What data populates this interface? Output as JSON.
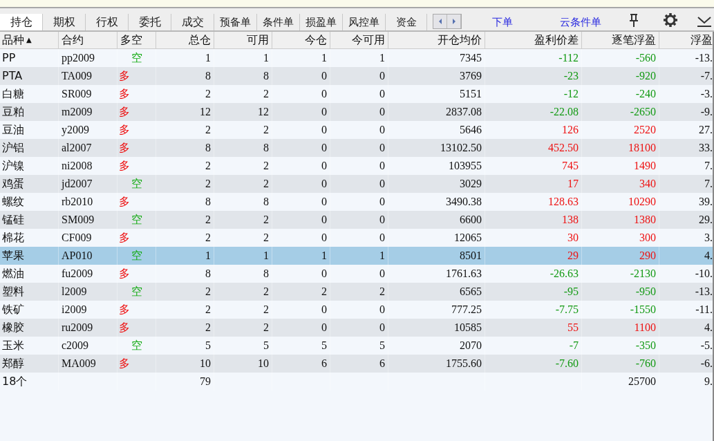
{
  "tabs": [
    {
      "label": "持仓",
      "selected": true
    },
    {
      "label": "期权",
      "selected": false
    },
    {
      "label": "行权",
      "selected": false
    },
    {
      "label": "委托",
      "selected": false
    },
    {
      "label": "成交",
      "selected": false
    },
    {
      "label": "预备单",
      "selected": false
    },
    {
      "label": "条件单",
      "selected": false
    },
    {
      "label": "损盈单",
      "selected": false
    },
    {
      "label": "风控单",
      "selected": false
    },
    {
      "label": "资金",
      "selected": false
    }
  ],
  "links": [
    "下单",
    "云条件单"
  ],
  "table": {
    "columns": [
      "品种",
      "合约",
      "多空",
      "总仓",
      "可用",
      "今仓",
      "今可用",
      "开仓均价",
      "盈利价差",
      "逐笔浮盈",
      "浮盈"
    ],
    "sort_indicator": "▲",
    "rows": [
      {
        "variety": "PP",
        "contract": "pp2009",
        "side": "空",
        "kind": "short",
        "total": "1",
        "available": "1",
        "today": "1",
        "today_available": "1",
        "avg_price": "7345",
        "spread": "-112",
        "float_pnl": "-560",
        "ratio": "-13.",
        "gain": false,
        "selected": false
      },
      {
        "variety": "PTA",
        "contract": "TA009",
        "side": "多",
        "kind": "long",
        "total": "8",
        "available": "8",
        "today": "0",
        "today_available": "0",
        "avg_price": "3769",
        "spread": "-23",
        "float_pnl": "-920",
        "ratio": "-7.",
        "gain": false,
        "selected": false
      },
      {
        "variety": "白糖",
        "contract": "SR009",
        "side": "多",
        "kind": "long",
        "total": "2",
        "available": "2",
        "today": "0",
        "today_available": "0",
        "avg_price": "5151",
        "spread": "-12",
        "float_pnl": "-240",
        "ratio": "-3.",
        "gain": false,
        "selected": false
      },
      {
        "variety": "豆粕",
        "contract": "m2009",
        "side": "多",
        "kind": "long",
        "total": "12",
        "available": "12",
        "today": "0",
        "today_available": "0",
        "avg_price": "2837.08",
        "spread": "-22.08",
        "float_pnl": "-2650",
        "ratio": "-9.",
        "gain": false,
        "selected": false
      },
      {
        "variety": "豆油",
        "contract": "y2009",
        "side": "多",
        "kind": "long",
        "total": "2",
        "available": "2",
        "today": "0",
        "today_available": "0",
        "avg_price": "5646",
        "spread": "126",
        "float_pnl": "2520",
        "ratio": "27.",
        "gain": true,
        "selected": false
      },
      {
        "variety": "沪铝",
        "contract": "al2007",
        "side": "多",
        "kind": "long",
        "total": "8",
        "available": "8",
        "today": "0",
        "today_available": "0",
        "avg_price": "13102.50",
        "spread": "452.50",
        "float_pnl": "18100",
        "ratio": "33.",
        "gain": true,
        "selected": false
      },
      {
        "variety": "沪镍",
        "contract": "ni2008",
        "side": "多",
        "kind": "long",
        "total": "2",
        "available": "2",
        "today": "0",
        "today_available": "0",
        "avg_price": "103955",
        "spread": "745",
        "float_pnl": "1490",
        "ratio": "7.",
        "gain": true,
        "selected": false
      },
      {
        "variety": "鸡蛋",
        "contract": "jd2007",
        "side": "空",
        "kind": "short",
        "total": "2",
        "available": "2",
        "today": "0",
        "today_available": "0",
        "avg_price": "3029",
        "spread": "17",
        "float_pnl": "340",
        "ratio": "7.",
        "gain": true,
        "selected": false
      },
      {
        "variety": "螺纹",
        "contract": "rb2010",
        "side": "多",
        "kind": "long",
        "total": "8",
        "available": "8",
        "today": "0",
        "today_available": "0",
        "avg_price": "3490.38",
        "spread": "128.63",
        "float_pnl": "10290",
        "ratio": "39.",
        "gain": true,
        "selected": false
      },
      {
        "variety": "锰硅",
        "contract": "SM009",
        "side": "空",
        "kind": "short",
        "total": "2",
        "available": "2",
        "today": "0",
        "today_available": "0",
        "avg_price": "6600",
        "spread": "138",
        "float_pnl": "1380",
        "ratio": "29.",
        "gain": true,
        "selected": false
      },
      {
        "variety": "棉花",
        "contract": "CF009",
        "side": "多",
        "kind": "long",
        "total": "2",
        "available": "2",
        "today": "0",
        "today_available": "0",
        "avg_price": "12065",
        "spread": "30",
        "float_pnl": "300",
        "ratio": "3.",
        "gain": true,
        "selected": false
      },
      {
        "variety": "苹果",
        "contract": "AP010",
        "side": "空",
        "kind": "short",
        "total": "1",
        "available": "1",
        "today": "1",
        "today_available": "1",
        "avg_price": "8501",
        "spread": "29",
        "float_pnl": "290",
        "ratio": "4.",
        "gain": true,
        "selected": true
      },
      {
        "variety": "燃油",
        "contract": "fu2009",
        "side": "多",
        "kind": "long",
        "total": "8",
        "available": "8",
        "today": "0",
        "today_available": "0",
        "avg_price": "1761.63",
        "spread": "-26.63",
        "float_pnl": "-2130",
        "ratio": "-10.",
        "gain": false,
        "selected": false
      },
      {
        "variety": "塑料",
        "contract": "l2009",
        "side": "空",
        "kind": "short",
        "total": "2",
        "available": "2",
        "today": "2",
        "today_available": "2",
        "avg_price": "6565",
        "spread": "-95",
        "float_pnl": "-950",
        "ratio": "-13.",
        "gain": false,
        "selected": false
      },
      {
        "variety": "铁矿",
        "contract": "i2009",
        "side": "多",
        "kind": "long",
        "total": "2",
        "available": "2",
        "today": "0",
        "today_available": "0",
        "avg_price": "777.25",
        "spread": "-7.75",
        "float_pnl": "-1550",
        "ratio": "-11.",
        "gain": false,
        "selected": false
      },
      {
        "variety": "橡胶",
        "contract": "ru2009",
        "side": "多",
        "kind": "long",
        "total": "2",
        "available": "2",
        "today": "0",
        "today_available": "0",
        "avg_price": "10585",
        "spread": "55",
        "float_pnl": "1100",
        "ratio": "4.",
        "gain": true,
        "selected": false
      },
      {
        "variety": "玉米",
        "contract": "c2009",
        "side": "空",
        "kind": "short",
        "total": "5",
        "available": "5",
        "today": "5",
        "today_available": "5",
        "avg_price": "2070",
        "spread": "-7",
        "float_pnl": "-350",
        "ratio": "-5.",
        "gain": false,
        "selected": false
      },
      {
        "variety": "郑醇",
        "contract": "MA009",
        "side": "多",
        "kind": "long",
        "total": "10",
        "available": "10",
        "today": "6",
        "today_available": "6",
        "avg_price": "1755.60",
        "spread": "-7.60",
        "float_pnl": "-760",
        "ratio": "-6.",
        "gain": false,
        "selected": false
      }
    ],
    "summary": {
      "count": "18个",
      "total": "79",
      "float_pnl": "25700",
      "ratio": "9."
    }
  }
}
